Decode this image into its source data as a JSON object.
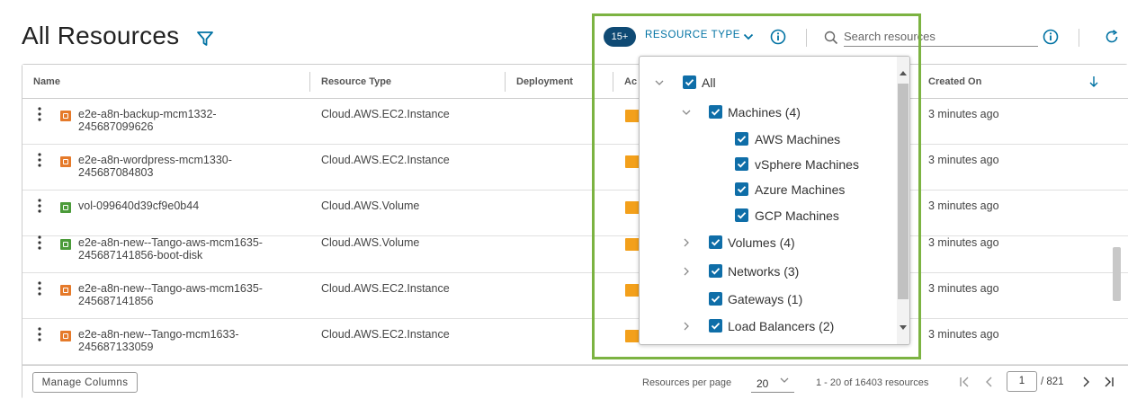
{
  "page": {
    "title": "All Resources"
  },
  "toolbar": {
    "filter_count_badge": "15+",
    "resource_type_label": "RESOURCE TYPE",
    "search_placeholder": "Search resources",
    "accent_color": "#0072a3",
    "badge_color": "#0f4a74"
  },
  "table": {
    "columns": [
      "Name",
      "Resource Type",
      "Deployment",
      "Ac",
      "Created On"
    ],
    "rows": [
      {
        "name": "e2e-a8n-backup-mcm1332-\n245687099626",
        "resource_type": "Cloud.AWS.EC2.Instance",
        "deployment": "",
        "created_on": "3 minutes ago",
        "icon": "ec2-instance-icon"
      },
      {
        "name": "e2e-a8n-wordpress-mcm1330-\n245687084803",
        "resource_type": "Cloud.AWS.EC2.Instance",
        "deployment": "",
        "created_on": "3 minutes ago",
        "icon": "ec2-instance-icon"
      },
      {
        "name": "vol-099640d39cf9e0b44",
        "resource_type": "Cloud.AWS.Volume",
        "deployment": "",
        "created_on": "3 minutes ago",
        "icon": "volume-icon"
      },
      {
        "name": "e2e-a8n-new--Tango-aws-mcm1635-\n245687141856-boot-disk",
        "resource_type": "Cloud.AWS.Volume",
        "deployment": "",
        "created_on": "3 minutes ago",
        "icon": "volume-icon"
      },
      {
        "name": "e2e-a8n-new--Tango-aws-mcm1635-\n245687141856",
        "resource_type": "Cloud.AWS.EC2.Instance",
        "deployment": "",
        "created_on": "3 minutes ago",
        "icon": "ec2-instance-icon"
      },
      {
        "name": "e2e-a8n-new--Tango-mcm1633-\n245687133059",
        "resource_type": "Cloud.AWS.EC2.Instance",
        "deployment": "",
        "created_on": "3 minutes ago",
        "icon": "ec2-instance-icon"
      }
    ]
  },
  "footer": {
    "manage_columns": "Manage Columns",
    "resources_per_page_label": "Resources per page",
    "resources_per_page_value": "20",
    "range_text": "1 - 20 of 16403 resources",
    "current_page": "1",
    "total_pages": "/ 821"
  },
  "resource_type_dropdown": {
    "items": [
      {
        "label": "All",
        "checked": true,
        "expanded": true
      },
      {
        "label": "Machines (4)",
        "checked": true,
        "expanded": true
      },
      {
        "label": "AWS Machines",
        "checked": true
      },
      {
        "label": "vSphere Machines",
        "checked": true
      },
      {
        "label": "Azure Machines",
        "checked": true
      },
      {
        "label": "GCP Machines",
        "checked": true
      },
      {
        "label": "Volumes (4)",
        "checked": true,
        "expanded": false
      },
      {
        "label": "Networks (3)",
        "checked": true,
        "expanded": false
      },
      {
        "label": "Gateways (1)",
        "checked": true
      },
      {
        "label": "Load Balancers (2)",
        "checked": true,
        "expanded": false
      }
    ],
    "checkbox_color": "#0f6ea8",
    "highlight_color": "#7cb342"
  }
}
